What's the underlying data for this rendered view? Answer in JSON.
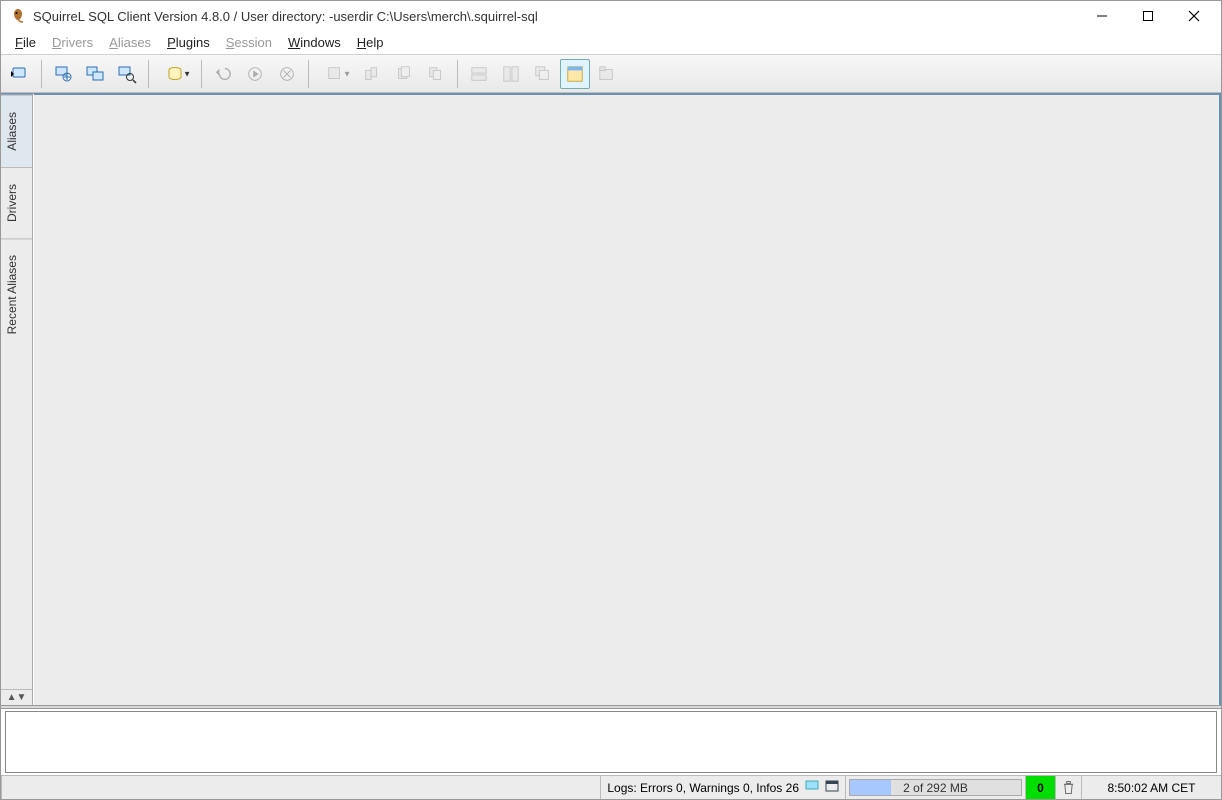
{
  "title": "SQuirreL SQL Client Version 4.8.0 / User directory: -userdir C:\\Users\\merch\\.squirrel-sql",
  "menu": {
    "file": "File",
    "drivers": "Drivers",
    "aliases": "Aliases",
    "plugins": "Plugins",
    "session": "Session",
    "windows": "Windows",
    "help": "Help"
  },
  "toolbar": {
    "connect": "connect",
    "new_session_props": "new-session-props",
    "global_prefs": "global-prefs",
    "find_alias": "find-alias",
    "saved_sessions": "saved-sessions",
    "rollback": "rollback",
    "run": "run",
    "stop": "stop",
    "new_obj": "new-obj",
    "paste": "paste",
    "copy": "copy",
    "copy_all": "copy-all",
    "tile_h": "tile-h",
    "tile_v": "tile-v",
    "cascade": "cascade",
    "maximize": "maximize",
    "tab_off": "tab-off"
  },
  "side_tabs": {
    "aliases": "Aliases",
    "drivers": "Drivers",
    "recent": "Recent Aliases"
  },
  "status": {
    "logs_label": "Logs: Errors 0, Warnings 0, Infos 26",
    "memory": "2 of 292 MB",
    "badge": "0",
    "clock": "8:50:02 AM CET"
  },
  "colors": {
    "accent_border": "#6b8fb0",
    "mem_fill": "#a6c8ff",
    "badge_bg": "#00dd00"
  }
}
